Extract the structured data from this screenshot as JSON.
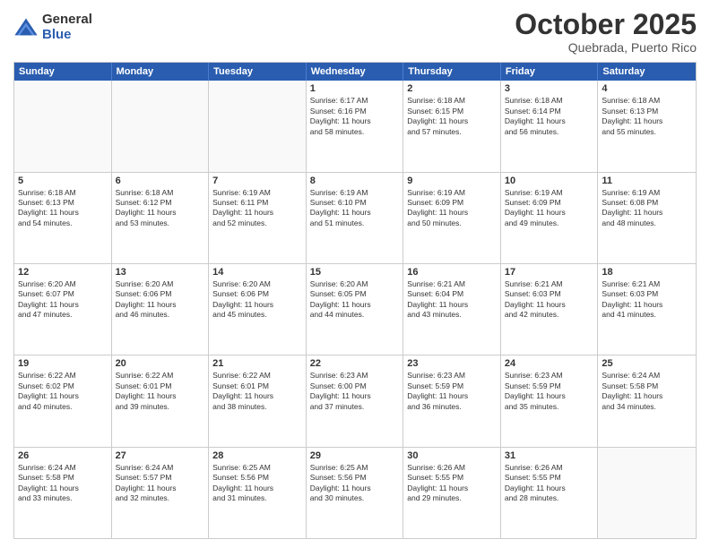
{
  "header": {
    "logo_general": "General",
    "logo_blue": "Blue",
    "month": "October 2025",
    "location": "Quebrada, Puerto Rico"
  },
  "days_of_week": [
    "Sunday",
    "Monday",
    "Tuesday",
    "Wednesday",
    "Thursday",
    "Friday",
    "Saturday"
  ],
  "weeks": [
    [
      {
        "day": "",
        "info": ""
      },
      {
        "day": "",
        "info": ""
      },
      {
        "day": "",
        "info": ""
      },
      {
        "day": "1",
        "info": "Sunrise: 6:17 AM\nSunset: 6:16 PM\nDaylight: 11 hours\nand 58 minutes."
      },
      {
        "day": "2",
        "info": "Sunrise: 6:18 AM\nSunset: 6:15 PM\nDaylight: 11 hours\nand 57 minutes."
      },
      {
        "day": "3",
        "info": "Sunrise: 6:18 AM\nSunset: 6:14 PM\nDaylight: 11 hours\nand 56 minutes."
      },
      {
        "day": "4",
        "info": "Sunrise: 6:18 AM\nSunset: 6:13 PM\nDaylight: 11 hours\nand 55 minutes."
      }
    ],
    [
      {
        "day": "5",
        "info": "Sunrise: 6:18 AM\nSunset: 6:13 PM\nDaylight: 11 hours\nand 54 minutes."
      },
      {
        "day": "6",
        "info": "Sunrise: 6:18 AM\nSunset: 6:12 PM\nDaylight: 11 hours\nand 53 minutes."
      },
      {
        "day": "7",
        "info": "Sunrise: 6:19 AM\nSunset: 6:11 PM\nDaylight: 11 hours\nand 52 minutes."
      },
      {
        "day": "8",
        "info": "Sunrise: 6:19 AM\nSunset: 6:10 PM\nDaylight: 11 hours\nand 51 minutes."
      },
      {
        "day": "9",
        "info": "Sunrise: 6:19 AM\nSunset: 6:09 PM\nDaylight: 11 hours\nand 50 minutes."
      },
      {
        "day": "10",
        "info": "Sunrise: 6:19 AM\nSunset: 6:09 PM\nDaylight: 11 hours\nand 49 minutes."
      },
      {
        "day": "11",
        "info": "Sunrise: 6:19 AM\nSunset: 6:08 PM\nDaylight: 11 hours\nand 48 minutes."
      }
    ],
    [
      {
        "day": "12",
        "info": "Sunrise: 6:20 AM\nSunset: 6:07 PM\nDaylight: 11 hours\nand 47 minutes."
      },
      {
        "day": "13",
        "info": "Sunrise: 6:20 AM\nSunset: 6:06 PM\nDaylight: 11 hours\nand 46 minutes."
      },
      {
        "day": "14",
        "info": "Sunrise: 6:20 AM\nSunset: 6:06 PM\nDaylight: 11 hours\nand 45 minutes."
      },
      {
        "day": "15",
        "info": "Sunrise: 6:20 AM\nSunset: 6:05 PM\nDaylight: 11 hours\nand 44 minutes."
      },
      {
        "day": "16",
        "info": "Sunrise: 6:21 AM\nSunset: 6:04 PM\nDaylight: 11 hours\nand 43 minutes."
      },
      {
        "day": "17",
        "info": "Sunrise: 6:21 AM\nSunset: 6:03 PM\nDaylight: 11 hours\nand 42 minutes."
      },
      {
        "day": "18",
        "info": "Sunrise: 6:21 AM\nSunset: 6:03 PM\nDaylight: 11 hours\nand 41 minutes."
      }
    ],
    [
      {
        "day": "19",
        "info": "Sunrise: 6:22 AM\nSunset: 6:02 PM\nDaylight: 11 hours\nand 40 minutes."
      },
      {
        "day": "20",
        "info": "Sunrise: 6:22 AM\nSunset: 6:01 PM\nDaylight: 11 hours\nand 39 minutes."
      },
      {
        "day": "21",
        "info": "Sunrise: 6:22 AM\nSunset: 6:01 PM\nDaylight: 11 hours\nand 38 minutes."
      },
      {
        "day": "22",
        "info": "Sunrise: 6:23 AM\nSunset: 6:00 PM\nDaylight: 11 hours\nand 37 minutes."
      },
      {
        "day": "23",
        "info": "Sunrise: 6:23 AM\nSunset: 5:59 PM\nDaylight: 11 hours\nand 36 minutes."
      },
      {
        "day": "24",
        "info": "Sunrise: 6:23 AM\nSunset: 5:59 PM\nDaylight: 11 hours\nand 35 minutes."
      },
      {
        "day": "25",
        "info": "Sunrise: 6:24 AM\nSunset: 5:58 PM\nDaylight: 11 hours\nand 34 minutes."
      }
    ],
    [
      {
        "day": "26",
        "info": "Sunrise: 6:24 AM\nSunset: 5:58 PM\nDaylight: 11 hours\nand 33 minutes."
      },
      {
        "day": "27",
        "info": "Sunrise: 6:24 AM\nSunset: 5:57 PM\nDaylight: 11 hours\nand 32 minutes."
      },
      {
        "day": "28",
        "info": "Sunrise: 6:25 AM\nSunset: 5:56 PM\nDaylight: 11 hours\nand 31 minutes."
      },
      {
        "day": "29",
        "info": "Sunrise: 6:25 AM\nSunset: 5:56 PM\nDaylight: 11 hours\nand 30 minutes."
      },
      {
        "day": "30",
        "info": "Sunrise: 6:26 AM\nSunset: 5:55 PM\nDaylight: 11 hours\nand 29 minutes."
      },
      {
        "day": "31",
        "info": "Sunrise: 6:26 AM\nSunset: 5:55 PM\nDaylight: 11 hours\nand 28 minutes."
      },
      {
        "day": "",
        "info": ""
      }
    ]
  ]
}
